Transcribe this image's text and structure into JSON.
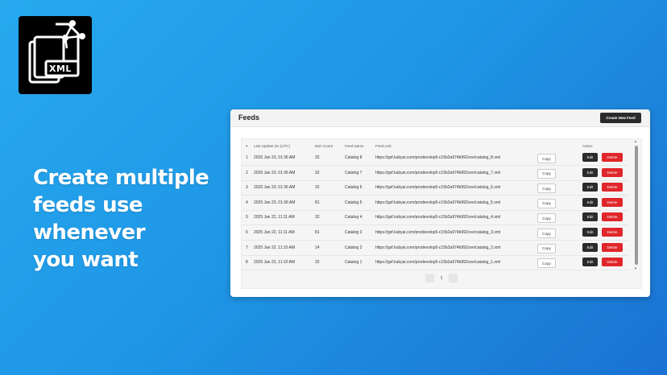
{
  "logo": {
    "text": "XML"
  },
  "hero": {
    "lines": [
      "Create multiple",
      "feeds use whenever",
      "you want"
    ]
  },
  "panel": {
    "title": "Feeds",
    "create_button": "Create New Feed",
    "columns": [
      "#",
      "Last Update On (UTC)",
      "Item Count",
      "Feed Name",
      "Feed Link",
      "Action"
    ],
    "rows": [
      {
        "num": "1",
        "date": "2025 Jan 23, 01:36 AM",
        "count": "32",
        "name": "Catalog 8",
        "link": "https://gsf.kubyai.com/prodevolop5-c15b2a974b992cee/catalog_8.xml"
      },
      {
        "num": "2",
        "date": "2025 Jan 23, 01:36 AM",
        "count": "32",
        "name": "Catalog 7",
        "link": "https://gsf.kubyai.com/prodevolop5-c15b2a974b992cee/catalog_7.xml"
      },
      {
        "num": "3",
        "date": "2025 Jan 23, 01:36 AM",
        "count": "32",
        "name": "Catalog 6",
        "link": "https://gsf.kubyai.com/prodevolop5-c15b2a974b992cee/catalog_6.xml"
      },
      {
        "num": "4",
        "date": "2025 Jan 23, 01:36 AM",
        "count": "81",
        "name": "Catalog 5",
        "link": "https://gsf.kubyai.com/prodevolop5-c15b2a974b992cee/catalog_5.xml"
      },
      {
        "num": "5",
        "date": "2025 Jan 22, 11:11 AM",
        "count": "32",
        "name": "Catalog 4",
        "link": "https://gsf.kubyai.com/prodevolop5-c15b2a974b992cee/catalog_4.xml"
      },
      {
        "num": "6",
        "date": "2025 Jan 22, 11:11 AM",
        "count": "81",
        "name": "Catalog 3",
        "link": "https://gsf.kubyai.com/prodevolop5-c15b2a974b992cee/catalog_3.xml"
      },
      {
        "num": "7",
        "date": "2025 Jan 22, 11:10 AM",
        "count": "14",
        "name": "Catalog 2",
        "link": "https://gsf.kubyai.com/prodevolop5-c15b2a974b992cee/catalog_2.xml"
      },
      {
        "num": "8",
        "date": "2025 Jan 22, 11:10 AM",
        "count": "32",
        "name": "Catalog 1",
        "link": "https://gsf.kubyai.com/prodevolop5-c15b2a974b992cee/catalog_1.xml"
      }
    ],
    "copy_label": "Copy",
    "edit_label": "Edit",
    "delete_label": "Delete",
    "current_page": "1"
  },
  "colors": {
    "accent_delete": "#e0262a",
    "dark_button": "#2b2b2b",
    "background_start": "#27a9ee",
    "background_end": "#1a72d2"
  },
  "icons": {
    "logo": "xml-file-share-icon",
    "scroll_up": "chevron-up-icon",
    "scroll_down": "chevron-down-icon"
  }
}
